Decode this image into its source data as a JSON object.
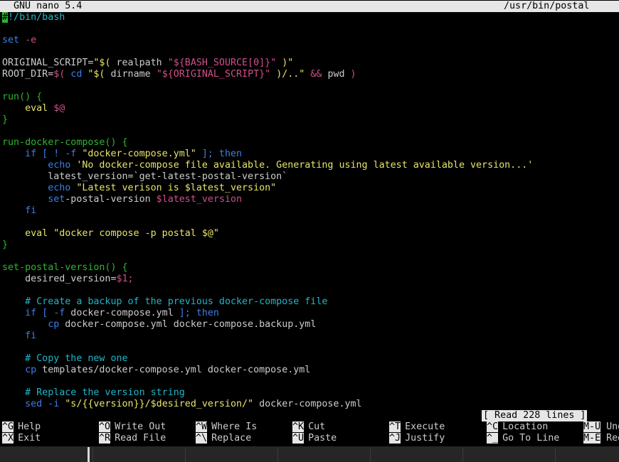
{
  "titlebar": {
    "left": "GNU nano 5.4",
    "right": "/usr/bin/postal"
  },
  "editor": {
    "lines": [
      [
        [
          "#",
          "cursor"
        ],
        [
          "!/bin/bash",
          "c-comment"
        ]
      ],
      [],
      [
        [
          "set",
          "c-kw"
        ],
        [
          " -e",
          "c-var"
        ]
      ],
      [],
      [
        [
          "ORIGINAL_SCRIPT=",
          "c-plain"
        ],
        [
          "\"$( ",
          "c-str"
        ],
        [
          "realpath ",
          "c-plain"
        ],
        [
          "\"${BASH_SOURCE[0]}\"",
          "c-var"
        ],
        [
          " )\"",
          "c-str"
        ]
      ],
      [
        [
          "ROOT_DIR=",
          "c-plain"
        ],
        [
          "$( ",
          "c-var"
        ],
        [
          "cd ",
          "c-kw"
        ],
        [
          "\"$( ",
          "c-str"
        ],
        [
          "dirname ",
          "c-plain"
        ],
        [
          "\"${ORIGINAL_SCRIPT}\"",
          "c-var"
        ],
        [
          " )/..\"",
          "c-str"
        ],
        [
          " && ",
          "c-var"
        ],
        [
          "pwd ",
          "c-plain"
        ],
        [
          ")",
          "c-var"
        ]
      ],
      [],
      [
        [
          "run() {",
          "c-fn"
        ]
      ],
      [
        [
          "    eval ",
          "c-str"
        ],
        [
          "$@",
          "c-var"
        ]
      ],
      [
        [
          "}",
          "c-fn"
        ]
      ],
      [],
      [
        [
          "run-docker-compose() {",
          "c-fn"
        ]
      ],
      [
        [
          "    if [ ! -f ",
          "c-kw"
        ],
        [
          "\"docker-compose.yml\"",
          "c-str"
        ],
        [
          " ]; then",
          "c-kw"
        ]
      ],
      [
        [
          "        echo ",
          "c-kw"
        ],
        [
          "'No docker-compose file available. Generating using latest available version...'",
          "c-str"
        ]
      ],
      [
        [
          "        latest_version=`get-latest-postal-version`",
          "c-plain"
        ]
      ],
      [
        [
          "        echo ",
          "c-kw"
        ],
        [
          "\"Latest verison is $latest_version\"",
          "c-str"
        ]
      ],
      [
        [
          "        set",
          "c-kw"
        ],
        [
          "-postal-version ",
          "c-plain"
        ],
        [
          "$latest_version",
          "c-var"
        ]
      ],
      [
        [
          "    fi",
          "c-kw"
        ]
      ],
      [],
      [
        [
          "    eval ",
          "c-str"
        ],
        [
          "\"docker compose -p postal $@\"",
          "c-str"
        ]
      ],
      [
        [
          "}",
          "c-fn"
        ]
      ],
      [],
      [
        [
          "set-postal-version() {",
          "c-fn"
        ]
      ],
      [
        [
          "    desired_version=",
          "c-plain"
        ],
        [
          "$1;",
          "c-var"
        ]
      ],
      [],
      [
        [
          "    # Create a backup of the previous docker-compose file",
          "c-comment"
        ]
      ],
      [
        [
          "    if [ -f ",
          "c-kw"
        ],
        [
          "docker-compose.yml ",
          "c-plain"
        ],
        [
          "]; then",
          "c-kw"
        ]
      ],
      [
        [
          "        cp ",
          "c-kw"
        ],
        [
          "docker-compose.yml docker-compose.backup.yml",
          "c-plain"
        ]
      ],
      [
        [
          "    fi",
          "c-kw"
        ]
      ],
      [],
      [
        [
          "    # Copy the new one",
          "c-comment"
        ]
      ],
      [
        [
          "    cp ",
          "c-kw"
        ],
        [
          "templates/docker-compose.yml docker-compose.yml",
          "c-plain"
        ]
      ],
      [],
      [
        [
          "    # Replace the version string",
          "c-comment"
        ]
      ],
      [
        [
          "    sed -i ",
          "c-kw"
        ],
        [
          "\"s/{{version}}/$desired_version/\"",
          "c-str"
        ],
        [
          " docker-compose.yml",
          "c-plain"
        ]
      ]
    ]
  },
  "status": {
    "message": "[ Read 228 lines ]"
  },
  "shortcuts": [
    {
      "key": "^G",
      "label": "Help"
    },
    {
      "key": "^X",
      "label": "Exit"
    },
    {
      "key": "^O",
      "label": "Write Out"
    },
    {
      "key": "^R",
      "label": "Read File"
    },
    {
      "key": "^W",
      "label": "Where Is"
    },
    {
      "key": "^\\",
      "label": "Replace"
    },
    {
      "key": "^K",
      "label": "Cut"
    },
    {
      "key": "^U",
      "label": "Paste"
    },
    {
      "key": "^T",
      "label": "Execute"
    },
    {
      "key": "^J",
      "label": "Justify"
    },
    {
      "key": "^C",
      "label": "Location"
    },
    {
      "key": "^_",
      "label": "Go To Line"
    },
    {
      "key": "M-U",
      "label": "Undo"
    },
    {
      "key": "M-E",
      "label": "Redo"
    }
  ],
  "colors": {
    "background": "#000000",
    "bar": "#e6e6e6",
    "comment": "#1fb6c9",
    "keyword": "#3c7ee6",
    "string": "#e8e36a",
    "variable": "#d04e8a",
    "function": "#2db52d"
  }
}
